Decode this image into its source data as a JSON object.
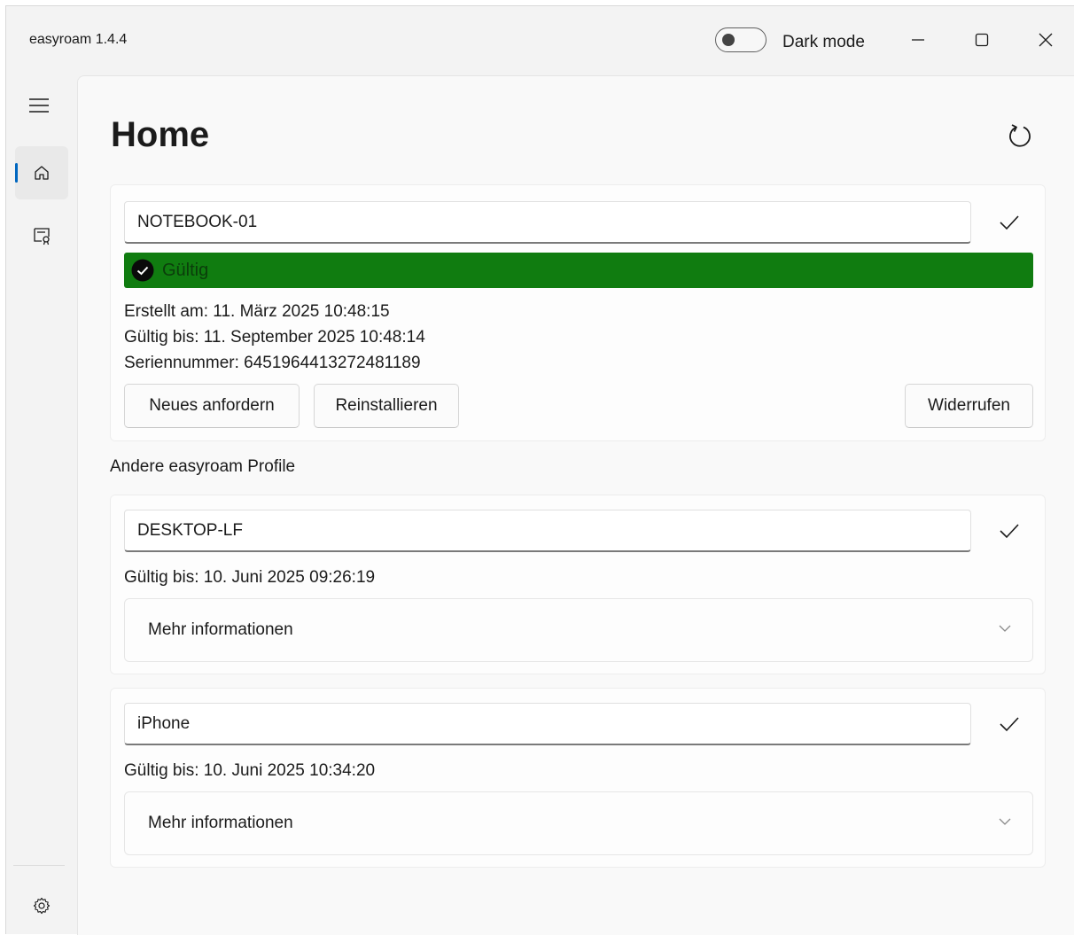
{
  "window": {
    "title": "easyroam 1.4.4",
    "dark_mode_label": "Dark mode",
    "dark_mode_on": false
  },
  "nav": {
    "items": [
      {
        "name": "home",
        "icon": "home-icon",
        "selected": true
      },
      {
        "name": "certificates",
        "icon": "certificate-icon",
        "selected": false
      }
    ],
    "footer": {
      "icon": "gear-icon"
    }
  },
  "page": {
    "title": "Home"
  },
  "current_profile": {
    "device_name": "NOTEBOOK-01",
    "status": "Gültig",
    "status_color": "#107c10",
    "created": "Erstellt am: 11. März 2025 10:48:15",
    "valid_until": "Gültig bis: 11. September 2025 10:48:14",
    "serial": "Seriennummer: 6451964413272481189",
    "buttons": {
      "request_new": "Neues anfordern",
      "reinstall": "Reinstallieren",
      "revoke": "Widerrufen"
    }
  },
  "other_profiles_label": "Andere easyroam Profile",
  "other_profiles": [
    {
      "device_name": "DESKTOP-LF",
      "valid_until": "Gültig bis: 10. Juni 2025 09:26:19",
      "more_info": "Mehr informationen"
    },
    {
      "device_name": "iPhone",
      "valid_until": "Gültig bis: 10. Juni 2025 10:34:20",
      "more_info": "Mehr informationen"
    }
  ],
  "accent_color": "#0067c0"
}
